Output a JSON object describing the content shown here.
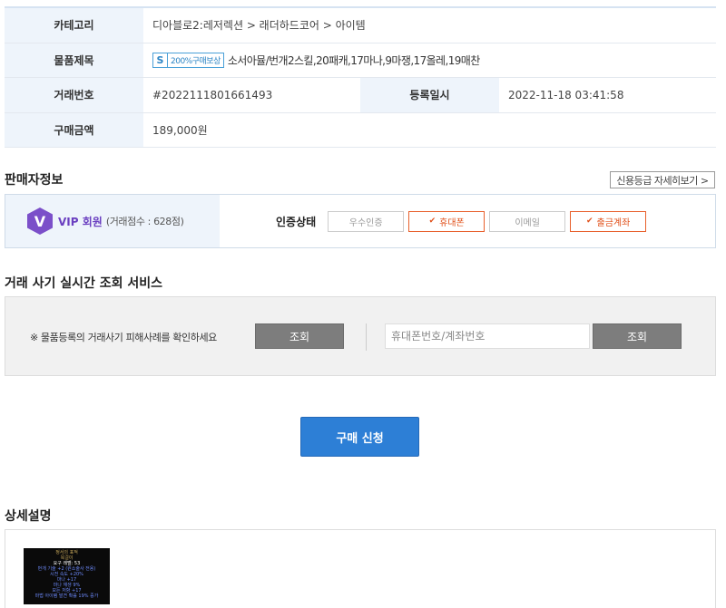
{
  "info": {
    "category_label": "카테고리",
    "category_value": "디아블로2:레저렉션 > 래더하드코어 > 아이템",
    "title_label": "물품제목",
    "title_badge_icon": "S",
    "title_badge": "200%구매보상",
    "title_value": "소서아뮬/번개2스킬,20패캐,17마나,9마쟁,17올레,19매찬",
    "trade_no_label": "거래번호",
    "trade_no_value": "#2022111801661493",
    "reg_date_label": "등록일시",
    "reg_date_value": "2022-11-18 03:41:58",
    "price_label": "구매금액",
    "price_value": "189,000원"
  },
  "seller": {
    "section_title": "판매자정보",
    "credit_button": "신용등급 자세히보기 >",
    "vip_icon": "V",
    "vip_label": "VIP 회원",
    "vip_score": "(거래점수 : 628점)",
    "auth_label": "인증상태",
    "auth_items": [
      {
        "label": "우수인증",
        "active": false
      },
      {
        "label": "휴대폰",
        "active": true
      },
      {
        "label": "이메일",
        "active": false
      },
      {
        "label": "출금계좌",
        "active": true
      }
    ],
    "active_color": "#e8602c"
  },
  "fraud": {
    "section_title": "거래 사기 실시간 조회 서비스",
    "notice": "※ 물품등록의 거래사기 피해사례를 확인하세요",
    "check_button_1": "조회",
    "input_placeholder": "휴대폰번호/계좌번호",
    "check_button_2": "조회"
  },
  "buy_button": "구매 신청",
  "detail": {
    "section_title": "상세설명",
    "item_lines": [
      {
        "text": "정서의 표적",
        "color": "#c8a85a"
      },
      {
        "text": "목걸이",
        "color": "#c8a85a"
      },
      {
        "text": "요구 레벨: 53",
        "color": "#ffffff"
      },
      {
        "text": "번개 기술 +2 (원소술사 전용)",
        "color": "#6f8cff"
      },
      {
        "text": "시전 속도 +20%",
        "color": "#6f8cff"
      },
      {
        "text": "마나 +17",
        "color": "#6f8cff"
      },
      {
        "text": "마나 재생 9%",
        "color": "#6f8cff"
      },
      {
        "text": "모든 저항 +17",
        "color": "#6f8cff"
      },
      {
        "text": "마법 아이템 발견 확률 19% 증가",
        "color": "#6f8cff"
      }
    ]
  },
  "colors": {
    "header_bg": "#eef4fb",
    "buy_button": "#2d7fd6",
    "vip": "#7b4fc9"
  }
}
